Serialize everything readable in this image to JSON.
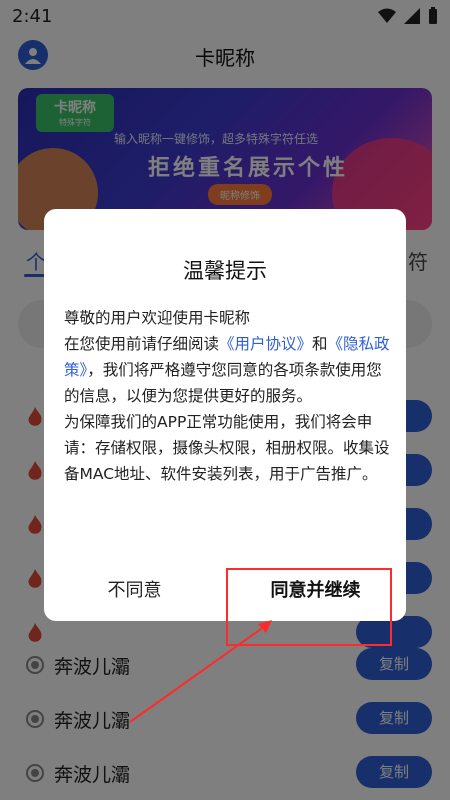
{
  "status": {
    "time": "2:41"
  },
  "header": {
    "title": "卡昵称"
  },
  "banner": {
    "logo_title": "卡昵称",
    "logo_sub": "特殊字符",
    "subtitle": "输入昵称一键修饰，超多特殊字符任选",
    "headline": "拒绝重名展示个性",
    "button": "昵称修饰"
  },
  "tabs": {
    "left": "个",
    "right": "符"
  },
  "list": {
    "rows": [
      {
        "name": "奔波儿灞",
        "copy": "复制"
      },
      {
        "name": "奔波儿灞",
        "copy": "复制"
      },
      {
        "name": "奔波儿灞",
        "copy": "复制"
      }
    ]
  },
  "dialog": {
    "title": "温馨提示",
    "line1": "尊敬的用户欢迎使用卡昵称",
    "line2_pre": "在您使用前请仔细阅读",
    "link_agreement": "《用户协议》",
    "and": "和",
    "link_privacy": "《隐私政策》",
    "line3_post": "，我们将严格遵守您同意的各项条款使用您的信息，以便为您提供更好的服务。",
    "line4": "为保障我们的APP正常功能使用，我们将会申请：存储权限，摄像头权限，相册权限。收集设备MAC地址、软件安装列表，用于广告推广。",
    "btn_disagree": "不同意",
    "btn_agree": "同意并继续"
  },
  "colors": {
    "accent": "#2f5fd6",
    "annotation": "#ff2a2a"
  }
}
